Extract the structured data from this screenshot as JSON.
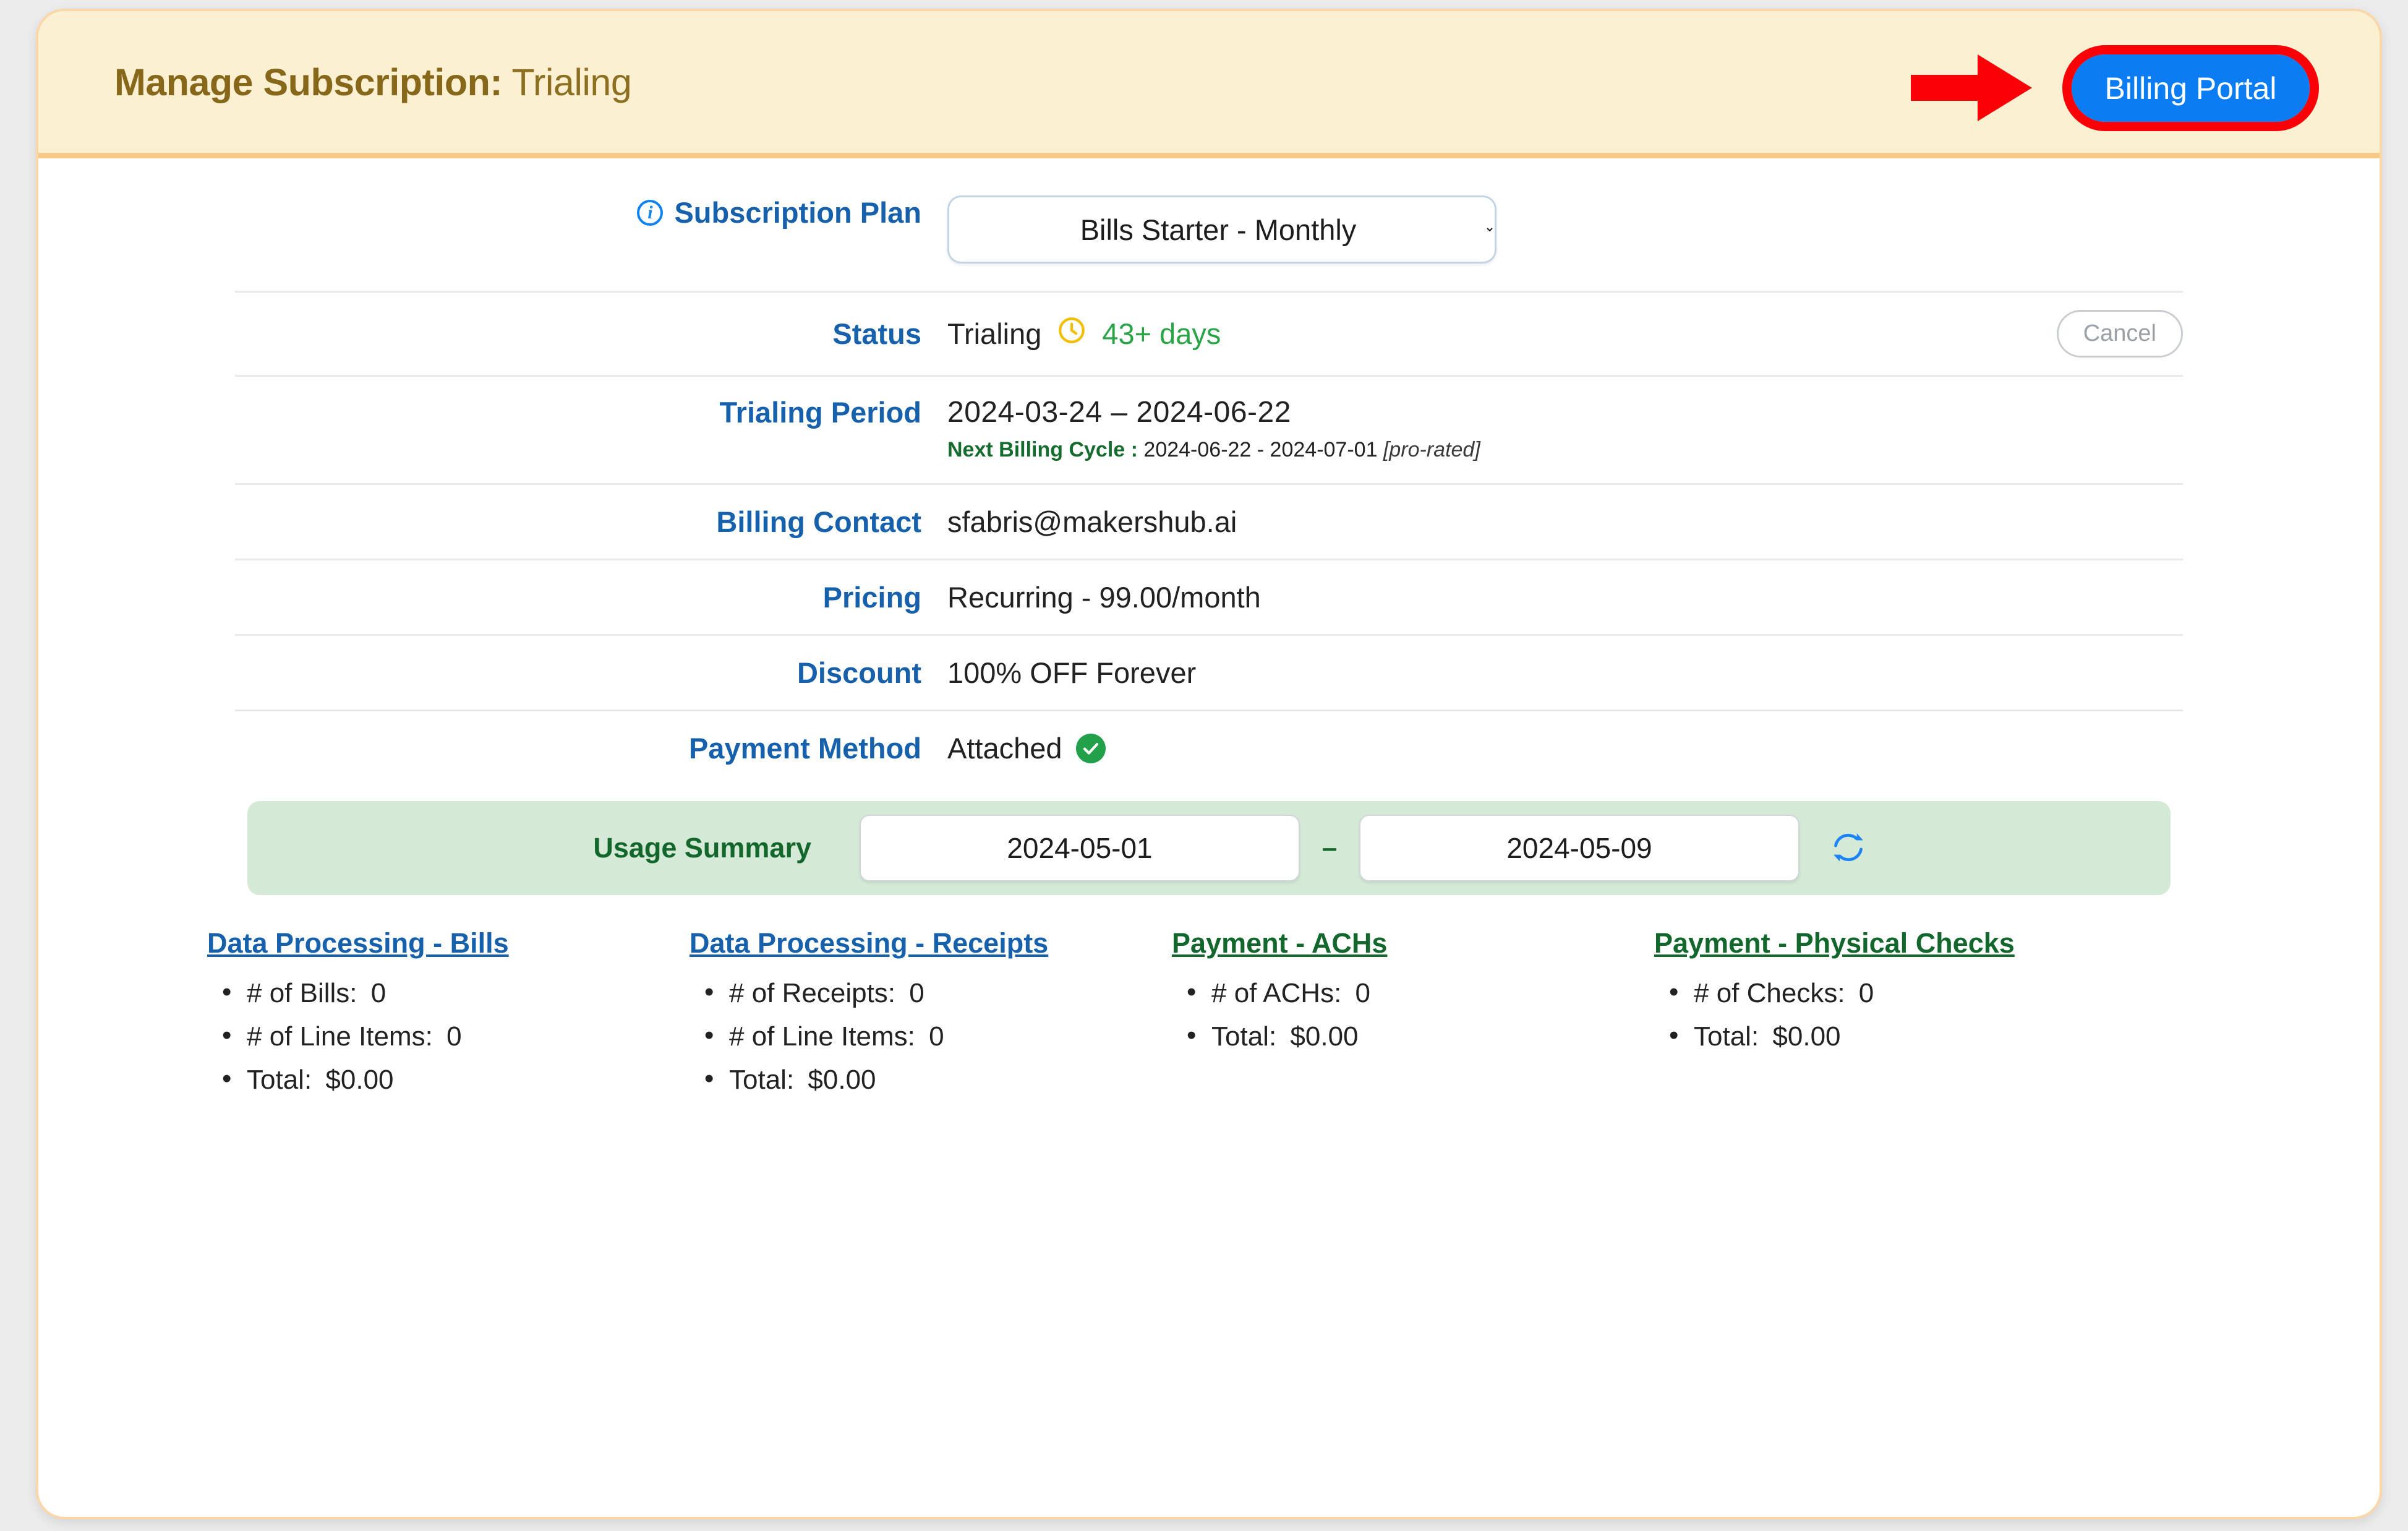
{
  "header": {
    "title_strong": "Manage Subscription:",
    "title_light": "Trialing",
    "billing_portal_label": "Billing Portal"
  },
  "details": {
    "plan": {
      "label": "Subscription Plan",
      "info_icon": "info-circle-icon",
      "value": "Bills Starter - Monthly"
    },
    "status": {
      "label": "Status",
      "value": "Trialing",
      "clock_icon": "clock-icon",
      "days_left": "43+ days",
      "cancel_label": "Cancel"
    },
    "trialing_period": {
      "label": "Trialing Period",
      "range": "2024-03-24 – 2024-06-22",
      "next_cycle_label": "Next Billing Cycle :",
      "next_cycle_range": "2024-06-22 - 2024-07-01",
      "prorated": "[pro-rated]"
    },
    "billing_contact": {
      "label": "Billing Contact",
      "value": "sfabris@makershub.ai"
    },
    "pricing": {
      "label": "Pricing",
      "value": "Recurring - 99.00/month"
    },
    "discount": {
      "label": "Discount",
      "value": "100% OFF Forever"
    },
    "payment_method": {
      "label": "Payment Method",
      "value": "Attached",
      "check_icon": "check-circle-icon"
    }
  },
  "usage_summary": {
    "label": "Usage Summary",
    "start_date": "2024-05-01",
    "dash": "–",
    "end_date": "2024-05-09",
    "refresh_icon": "refresh-icon",
    "columns": [
      {
        "title": "Data Processing - Bills",
        "color": "blue",
        "items": [
          {
            "label": "# of Bills:",
            "value": "0"
          },
          {
            "label": "# of Line Items:",
            "value": "0"
          },
          {
            "label": "Total:",
            "value": "$0.00"
          }
        ]
      },
      {
        "title": "Data Processing - Receipts",
        "color": "blue",
        "items": [
          {
            "label": "# of Receipts:",
            "value": "0"
          },
          {
            "label": "# of Line Items:",
            "value": "0"
          },
          {
            "label": "Total:",
            "value": "$0.00"
          }
        ]
      },
      {
        "title": "Payment - ACHs",
        "color": "green",
        "items": [
          {
            "label": "# of ACHs:",
            "value": "0"
          },
          {
            "label": "Total:",
            "value": "$0.00"
          }
        ]
      },
      {
        "title": "Payment - Physical Checks",
        "color": "green",
        "items": [
          {
            "label": "# of Checks:",
            "value": "0"
          },
          {
            "label": "Total:",
            "value": "$0.00"
          }
        ]
      }
    ]
  },
  "colors": {
    "header_bg": "#fcf0d2",
    "header_border": "#f7c987",
    "header_text": "#87671a",
    "label_blue": "#1761ac",
    "accent_blue": "#0b7cf2",
    "annotation_red": "#fb0007",
    "green_dark": "#14672c",
    "green_check": "#22a14a",
    "green_days": "#2aa447",
    "clock_yellow": "#f5bd00",
    "usage_bar_bg": "#d4ead6",
    "card_border": "#fad7a8"
  }
}
